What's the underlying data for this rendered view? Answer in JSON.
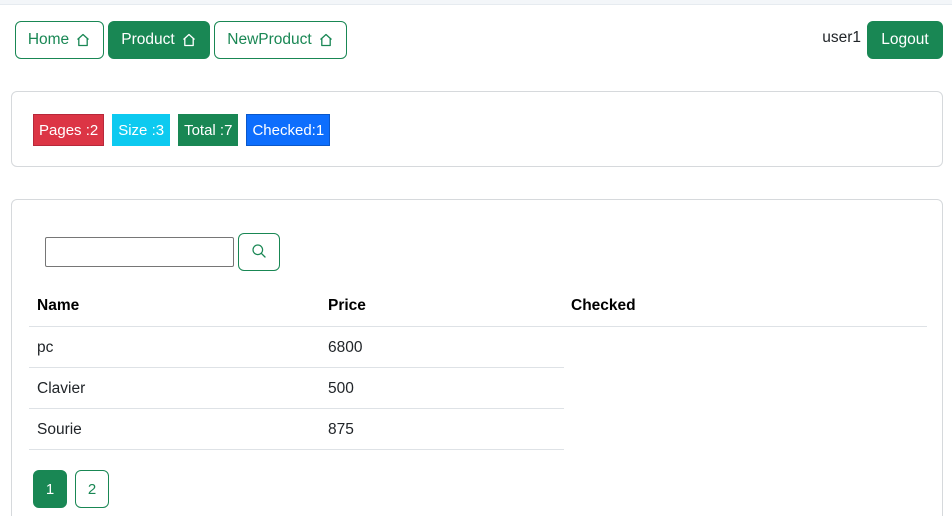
{
  "nav": {
    "links": [
      {
        "label": "Home",
        "icon": "home-icon",
        "active": false
      },
      {
        "label": "Product",
        "icon": "home-icon",
        "active": true
      },
      {
        "label": "NewProduct",
        "icon": "home-icon",
        "active": false
      }
    ],
    "user": "user1",
    "logout_label": "Logout"
  },
  "stats": {
    "pages": "Pages :2",
    "size": "Size :3",
    "total": "Total :7",
    "checked": "Checked:1"
  },
  "search": {
    "value": "",
    "placeholder": "",
    "button_icon": "search-icon"
  },
  "table": {
    "headers": [
      "Name",
      "Price",
      "Checked"
    ],
    "rows": [
      {
        "name": "pc",
        "price": "6800",
        "checked": ""
      },
      {
        "name": "Clavier",
        "price": "500",
        "checked": ""
      },
      {
        "name": "Sourie",
        "price": "875",
        "checked": ""
      }
    ]
  },
  "pagination": {
    "pages": [
      "1",
      "2"
    ],
    "current": "1"
  },
  "colors": {
    "primary_green": "#198754",
    "danger": "#dc3545",
    "info": "#0dcaf0",
    "blue": "#0d6efd"
  }
}
